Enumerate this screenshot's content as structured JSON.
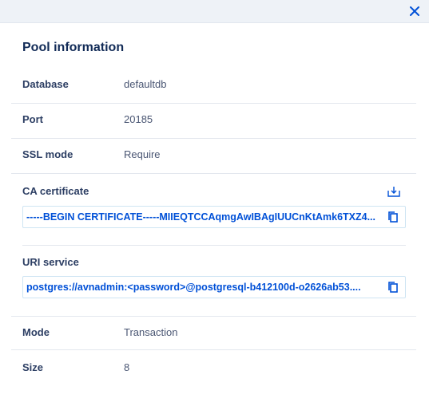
{
  "dialog": {
    "title": "Pool information",
    "close_icon": "close-icon"
  },
  "fields": {
    "database": {
      "label": "Database",
      "value": "defaultdb"
    },
    "port": {
      "label": "Port",
      "value": "20185"
    },
    "ssl_mode": {
      "label": "SSL mode",
      "value": "Require"
    },
    "ca_certificate": {
      "label": "CA certificate",
      "value": "-----BEGIN CERTIFICATE-----MIIEQTCCAqmgAwIBAgIUUCnKtAmk6TXZ4...",
      "download_icon": "download-icon",
      "copy_icon": "copy-icon"
    },
    "uri_service": {
      "label": "URI service",
      "value": "postgres://avnadmin:<password>@postgresql-b412100d-o2626ab53....",
      "copy_icon": "copy-icon"
    },
    "mode": {
      "label": "Mode",
      "value": "Transaction"
    },
    "size": {
      "label": "Size",
      "value": "8"
    }
  },
  "colors": {
    "accent": "#0050d7",
    "title": "#122b57",
    "topbar": "#eef2f7"
  }
}
